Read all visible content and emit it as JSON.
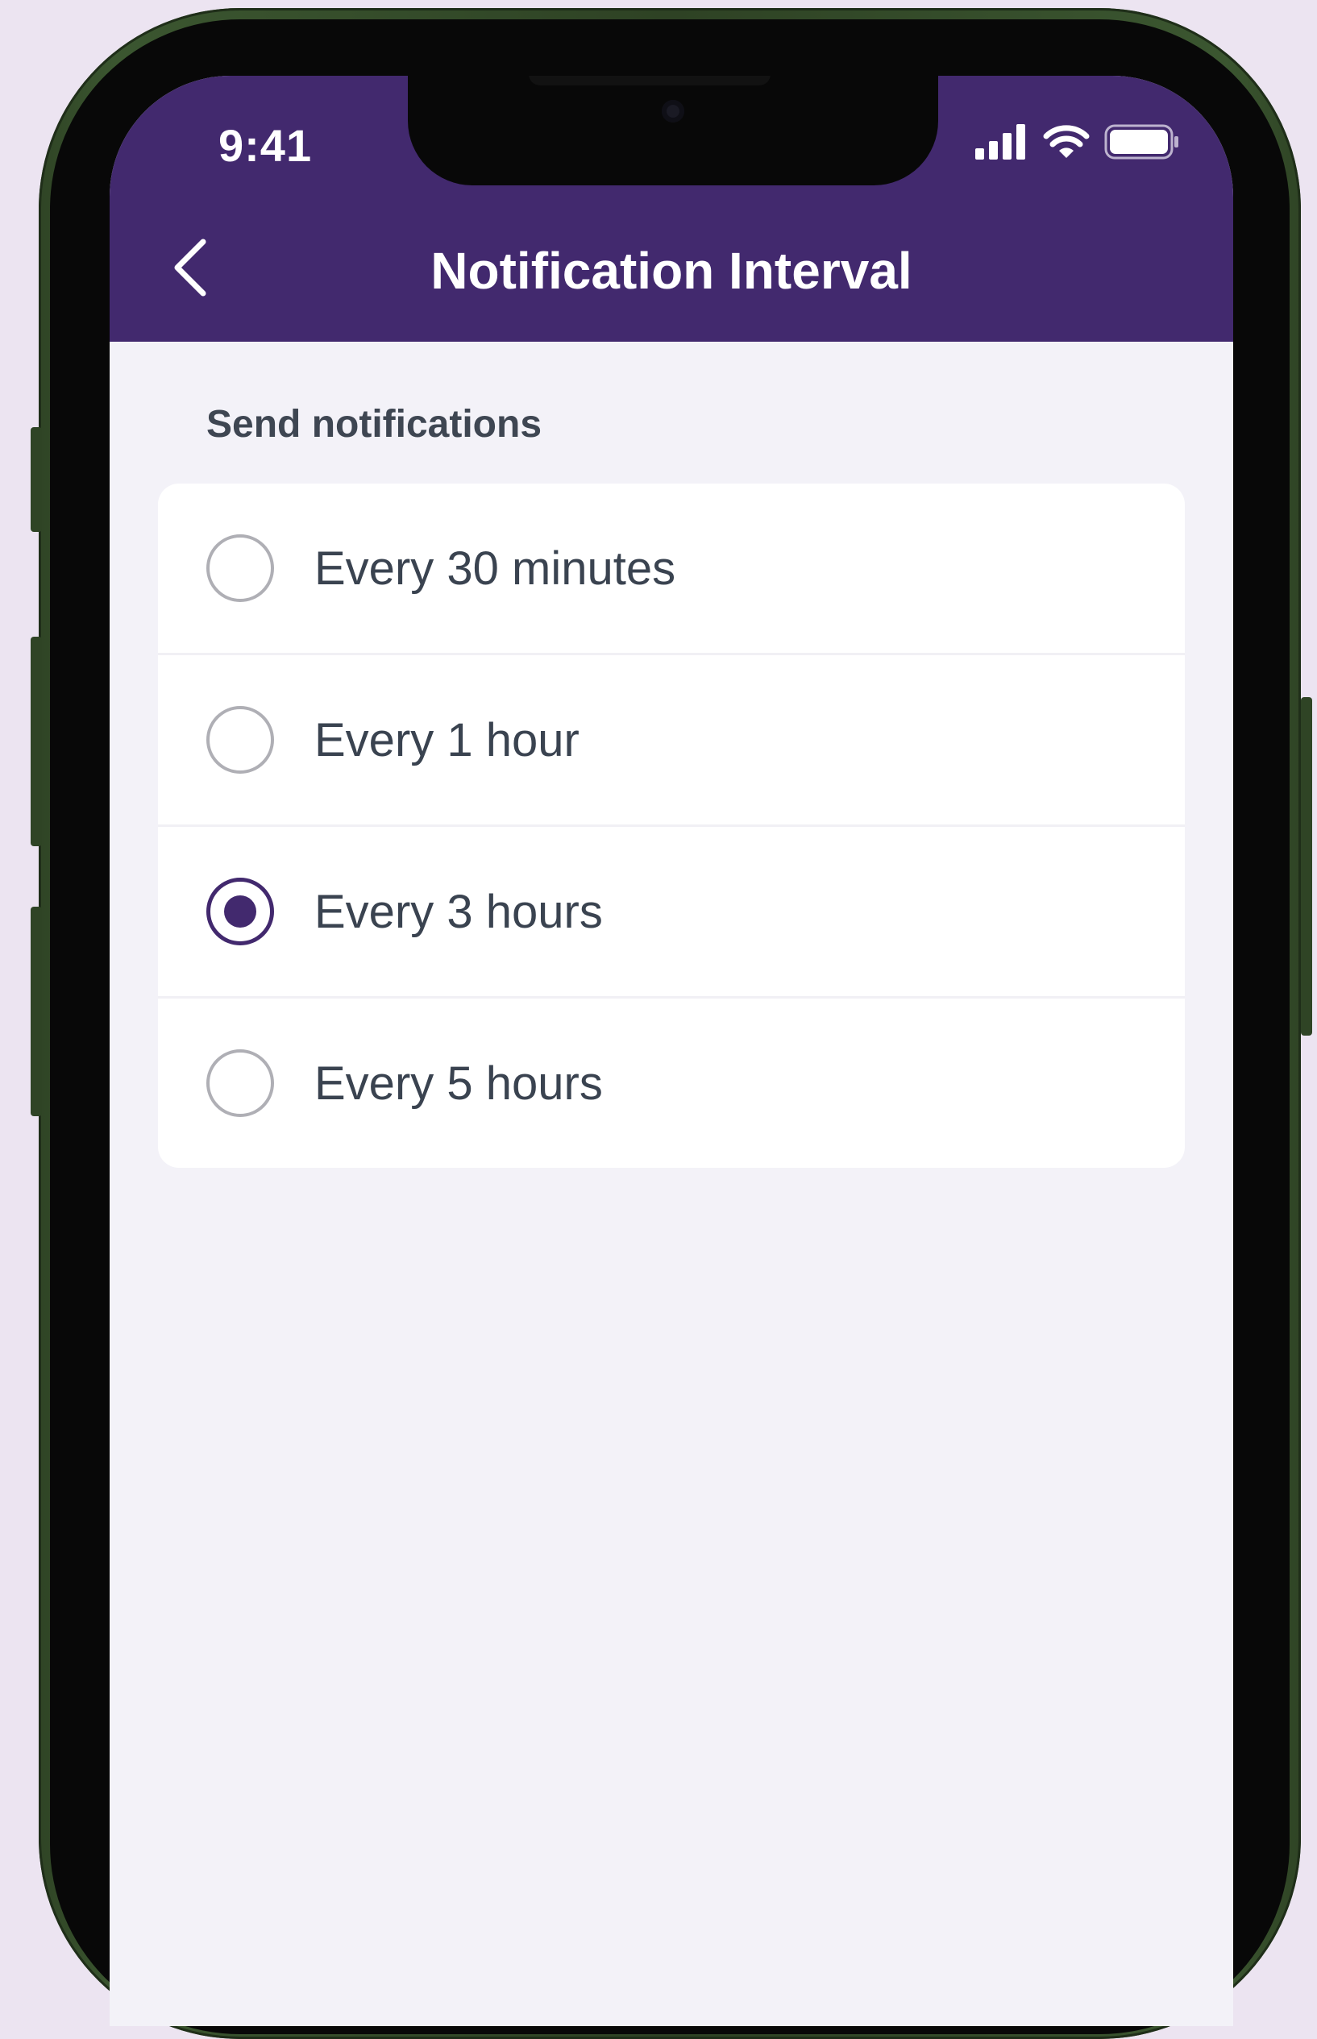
{
  "status_bar": {
    "time": "9:41",
    "icons": [
      "cellular-signal-icon",
      "wifi-icon",
      "battery-icon"
    ]
  },
  "header": {
    "back_icon": "chevron-left-icon",
    "title": "Notification Interval"
  },
  "section": {
    "label": "Send notifications"
  },
  "options": [
    {
      "label": "Every 30 minutes",
      "selected": false
    },
    {
      "label": "Every 1 hour",
      "selected": false
    },
    {
      "label": "Every 3 hours",
      "selected": true
    },
    {
      "label": "Every 5 hours",
      "selected": false
    }
  ],
  "colors": {
    "header_background": "#42296E",
    "accent": "#42296E",
    "page_background": "#F3F2F8",
    "card_background": "#FFFFFF",
    "outer_background": "#ECE4F1",
    "phone_frame": "#2F4425"
  }
}
